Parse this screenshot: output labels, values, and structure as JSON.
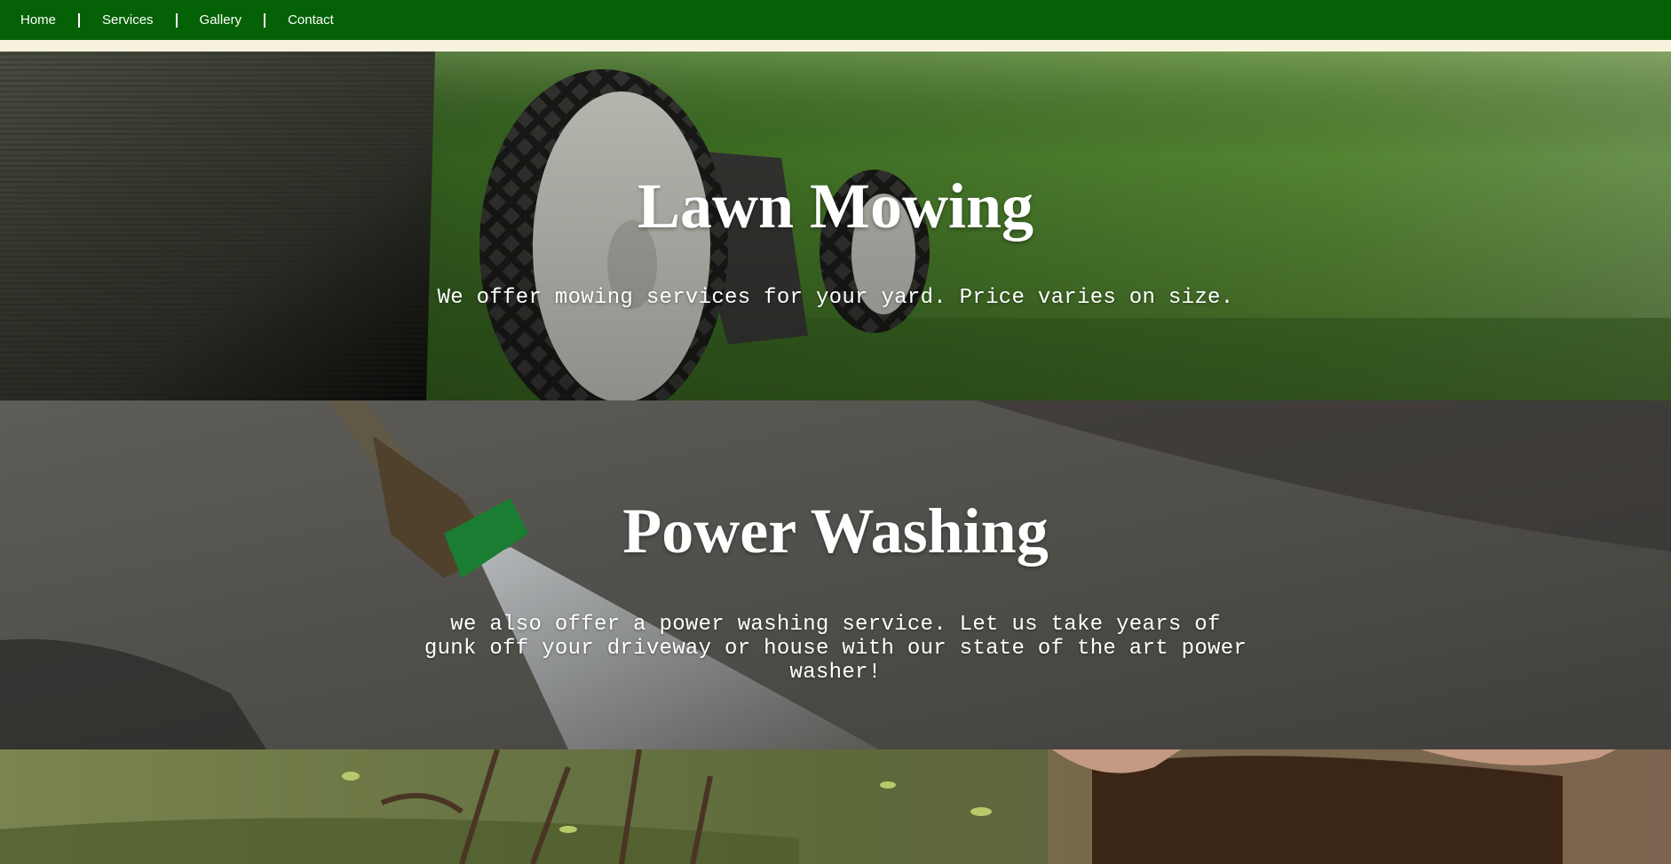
{
  "nav": {
    "items": [
      {
        "label": "Home"
      },
      {
        "label": "Services"
      },
      {
        "label": "Gallery"
      },
      {
        "label": "Contact"
      }
    ]
  },
  "sections": [
    {
      "title": "Lawn Mowing",
      "description": "We offer mowing services for your yard. Price varies on size."
    },
    {
      "title": "Power Washing",
      "description": "we also offer a power washing service. Let us take years of gunk off your driveway or house with our state of the art power washer!"
    }
  ],
  "colors": {
    "nav_background": "#056105",
    "nav_text": "#ffffff",
    "strip": "#f6f2dc",
    "heading_text": "#ffffff"
  },
  "icons": {
    "nav_separator": "vertical-bar"
  }
}
